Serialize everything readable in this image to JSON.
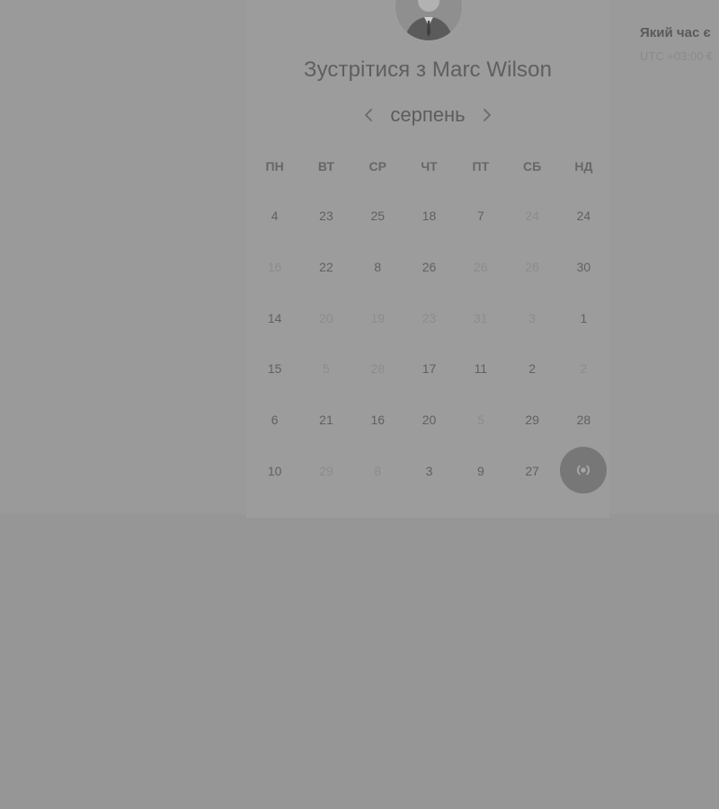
{
  "colors": {
    "overlay_background": "#969696",
    "card_background": "#9c9c9c",
    "fab_background": "#777777"
  },
  "host": {
    "avatar_icon": "person-avatar-icon"
  },
  "meeting": {
    "title": "Зустрітися з Marc Wilson"
  },
  "calendar": {
    "month": "серпень",
    "prev_icon": "chevron-left-icon",
    "next_icon": "chevron-right-icon",
    "weekdays": [
      "ПН",
      "ВТ",
      "СР",
      "ЧТ",
      "ПТ",
      "СБ",
      "НД"
    ],
    "weeks": [
      [
        {
          "t": "4",
          "m": false
        },
        {
          "t": "23",
          "m": false
        },
        {
          "t": "25",
          "m": false
        },
        {
          "t": "18",
          "m": false
        },
        {
          "t": "7",
          "m": false
        },
        {
          "t": "24",
          "m": true
        },
        {
          "t": "24",
          "m": false
        }
      ],
      [
        {
          "t": "16",
          "m": true
        },
        {
          "t": "22",
          "m": false
        },
        {
          "t": "8",
          "m": false
        },
        {
          "t": "26",
          "m": false
        },
        {
          "t": "26",
          "m": true
        },
        {
          "t": "26",
          "m": true
        },
        {
          "t": "30",
          "m": false
        }
      ],
      [
        {
          "t": "14",
          "m": false
        },
        {
          "t": "20",
          "m": true
        },
        {
          "t": "19",
          "m": true
        },
        {
          "t": "23",
          "m": true
        },
        {
          "t": "31",
          "m": true
        },
        {
          "t": "3",
          "m": true
        },
        {
          "t": "1",
          "m": false
        }
      ],
      [
        {
          "t": "15",
          "m": false
        },
        {
          "t": "5",
          "m": true
        },
        {
          "t": "28",
          "m": true
        },
        {
          "t": "17",
          "m": false
        },
        {
          "t": "11",
          "m": false
        },
        {
          "t": "2",
          "m": false
        },
        {
          "t": "2",
          "m": true
        }
      ],
      [
        {
          "t": "6",
          "m": false
        },
        {
          "t": "21",
          "m": false
        },
        {
          "t": "16",
          "m": false
        },
        {
          "t": "20",
          "m": false
        },
        {
          "t": "5",
          "m": true
        },
        {
          "t": "29",
          "m": false
        },
        {
          "t": "28",
          "m": false
        }
      ],
      [
        {
          "t": "10",
          "m": false
        },
        {
          "t": "29",
          "m": true
        },
        {
          "t": "8",
          "m": true
        },
        {
          "t": "3",
          "m": false
        },
        {
          "t": "9",
          "m": false
        },
        {
          "t": "27",
          "m": false
        },
        {
          "t": "",
          "m": false
        }
      ]
    ]
  },
  "fab": {
    "icon": "broadcast-icon"
  },
  "timezone": {
    "question": "Який час є",
    "offset": "UTC +03:00 €"
  }
}
